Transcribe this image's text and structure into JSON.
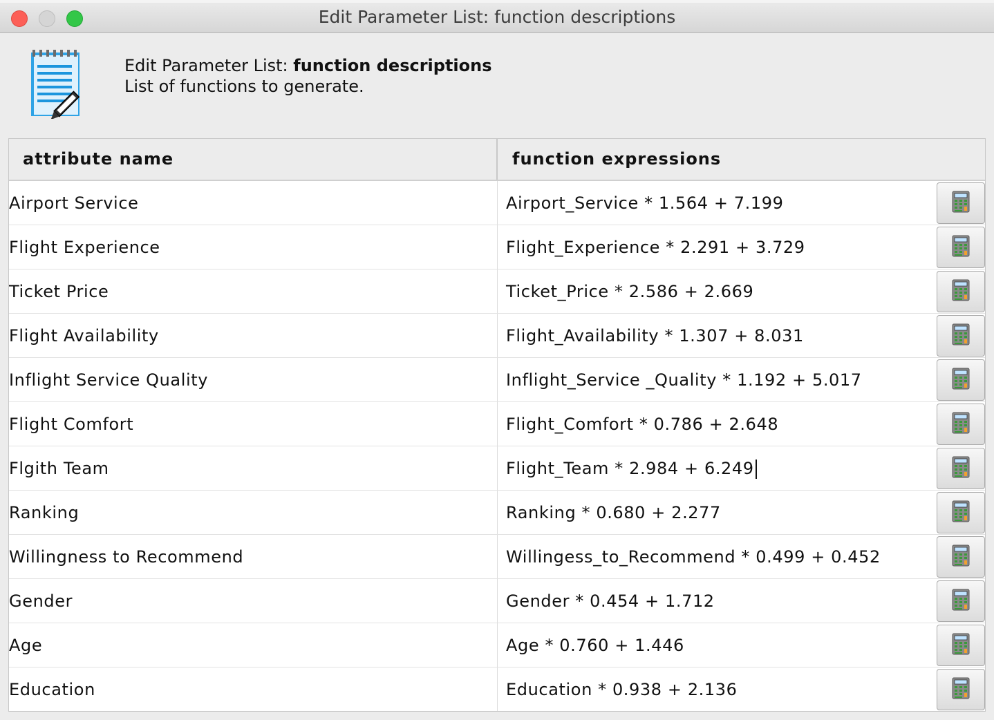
{
  "window": {
    "title": "Edit Parameter List: function descriptions"
  },
  "header": {
    "icon": "notepad-pencil-icon",
    "title_prefix": "Edit Parameter List: ",
    "title_bold": "function descriptions",
    "description": "List of functions to generate."
  },
  "table": {
    "columns": [
      "attribute name",
      "function expressions"
    ],
    "button_icon": "calculator-icon",
    "rows": [
      {
        "name": "Airport Service",
        "expression": "Airport_Service * 1.564 + 7.199"
      },
      {
        "name": "Flight Experience",
        "expression": "Flight_Experience * 2.291 + 3.729"
      },
      {
        "name": "Ticket Price",
        "expression": "Ticket_Price * 2.586 + 2.669"
      },
      {
        "name": "Flight Availability",
        "expression": "Flight_Availability * 1.307 + 8.031"
      },
      {
        "name": "Inflight Service Quality",
        "expression": "Inflight_Service _Quality * 1.192 + 5.017"
      },
      {
        "name": "Flight Comfort",
        "expression": "Flight_Comfort * 0.786 + 2.648"
      },
      {
        "name": "Flgith Team",
        "expression": "Flight_Team * 2.984 + 6.249"
      },
      {
        "name": "Ranking",
        "expression": "Ranking * 0.680 + 2.277"
      },
      {
        "name": "Willingness to Recommend",
        "expression": "Willingess_to_Recommend * 0.499 + 0.452"
      },
      {
        "name": "Gender",
        "expression": "Gender * 0.454 + 1.712"
      },
      {
        "name": "Age",
        "expression": "Age * 0.760 + 1.446"
      },
      {
        "name": "Education",
        "expression": "Education * 0.938 + 2.136"
      }
    ]
  }
}
